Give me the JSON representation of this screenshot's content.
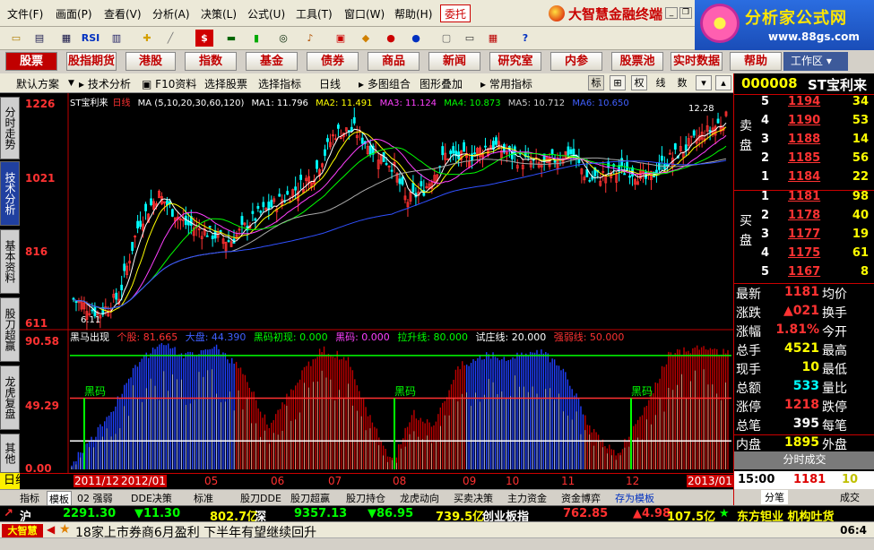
{
  "menu": {
    "items": [
      "文件(F)",
      "画面(P)",
      "查看(V)",
      "分析(A)",
      "决策(L)",
      "公式(U)",
      "工具(T)",
      "窗口(W)",
      "帮助(H)"
    ],
    "active": "委托",
    "brand": "大智慧金融终端"
  },
  "ad": {
    "title": "分析家公式网",
    "url": "www.88gs.com"
  },
  "toolbar": {
    "rsi_label": "RSI"
  },
  "funcbar": {
    "items": [
      "股票",
      "股指期货",
      "港股",
      "指数",
      "基金",
      "债券",
      "商品",
      "新闻",
      "研究室",
      "内参",
      "股票池",
      "实时数据",
      "帮助"
    ],
    "workarea": "工作区"
  },
  "subbar": {
    "default_scheme": "默认方案",
    "tech_analysis": "技术分析",
    "f10": "F10资料",
    "pick_stock": "选择股票",
    "pick_indicator": "选择指标",
    "period": "日线",
    "multi_chart": "多图组合",
    "overlay": "图形叠加",
    "common_ind": "常用指标",
    "btn_biao": "标",
    "btn_quan": "权",
    "btn_xian": "线",
    "btn_shu": "数"
  },
  "lefttabs": [
    "分时走势",
    "技术分析",
    "基本资料",
    "股刀超赢",
    "龙虎复盘",
    "其他"
  ],
  "main_chart": {
    "title": "ST宝利来",
    "period": "日线",
    "ma_params": "MA (5,10,20,30,60,120)",
    "ma1": "MA1: 11.796",
    "ma2": "MA2: 11.491",
    "ma3": "MA3: 11.124",
    "ma4": "MA4: 10.873",
    "ma5": "MA5: 10.712",
    "ma6": "MA6: 10.650",
    "yticks": [
      "1226",
      "1021",
      "816",
      "611"
    ],
    "max_label": "12.28",
    "min_label": "6.11"
  },
  "indicator": {
    "name": "黑马出现",
    "geti": "个股: 81.665",
    "dapan": "大盘: 44.390",
    "chuxian": "黑码初现: 0.000",
    "heima": "黑码: 0.000",
    "lashengxian": "拉升线: 80.000",
    "shizhuangxian": "试庄线: 20.000",
    "qiangruoxian": "强弱线: 50.000",
    "yticks": [
      "90.58",
      "49.29",
      "0.00"
    ],
    "signal_label": "黑码"
  },
  "chart_data": {
    "type": "candlestick",
    "title": "ST宝利来",
    "ylim": [
      611,
      1226
    ],
    "x_labels": [
      "2011/12",
      "2012/01",
      "05",
      "06",
      "07",
      "08",
      "09",
      "10",
      "11",
      "12",
      "2013/01"
    ],
    "indicator_ylim": [
      0,
      90.58
    ],
    "levels": {
      "lashengxian": 80,
      "qiangruoxian": 50,
      "shizhuangxian": 20
    }
  },
  "xaxis": {
    "period_label": "日线",
    "labels": [
      "2011/12",
      "2012/01",
      "05",
      "06",
      "07",
      "08",
      "09",
      "10",
      "11",
      "12",
      "2013/01"
    ]
  },
  "bottom_tabs": [
    "指标",
    "模板",
    "02 强弱",
    "DDE决策",
    "标准",
    "股刀DDE",
    "股刀超赢",
    "股刀持仓",
    "龙虎动向",
    "买卖决策",
    "主力资金",
    "资金博弈",
    "存为模板"
  ],
  "stock": {
    "code": "000008",
    "name": "ST宝利来"
  },
  "orderbook": {
    "sell_label": "卖盘",
    "buy_label": "买盘",
    "sell": [
      {
        "level": "5",
        "price": "1194",
        "qty": "34"
      },
      {
        "level": "4",
        "price": "1190",
        "qty": "53"
      },
      {
        "level": "3",
        "price": "1188",
        "qty": "14"
      },
      {
        "level": "2",
        "price": "1185",
        "qty": "56"
      },
      {
        "level": "1",
        "price": "1184",
        "qty": "22"
      }
    ],
    "buy": [
      {
        "level": "1",
        "price": "1181",
        "qty": "98"
      },
      {
        "level": "2",
        "price": "1178",
        "qty": "40"
      },
      {
        "level": "3",
        "price": "1177",
        "qty": "19"
      },
      {
        "level": "4",
        "price": "1175",
        "qty": "61"
      },
      {
        "level": "5",
        "price": "1167",
        "qty": "8"
      }
    ]
  },
  "quote": [
    {
      "l1": "最新",
      "v": "1181",
      "l2": "均价",
      "color": "#ff3232"
    },
    {
      "l1": "涨跌",
      "v": "▲021",
      "l2": "换手",
      "color": "#ff3232"
    },
    {
      "l1": "涨幅",
      "v": "1.81%",
      "l2": "今开",
      "color": "#ff3232"
    },
    {
      "l1": "总手",
      "v": "4521",
      "l2": "最高",
      "color": "#ffff00"
    },
    {
      "l1": "现手",
      "v": "10",
      "l2": "最低",
      "color": "#ffff00"
    },
    {
      "l1": "总额",
      "v": "533",
      "l2": "量比",
      "color": "#00ffff"
    },
    {
      "l1": "涨停",
      "v": "1218",
      "l2": "跌停",
      "color": "#ff3232"
    },
    {
      "l1": "总笔",
      "v": "395",
      "l2": "每笔",
      "color": "#ffffff"
    },
    {
      "l1": "内盘",
      "v": "1895",
      "l2": "外盘",
      "color": "#ffff00"
    }
  ],
  "timeshare": {
    "title": "分时成交",
    "time": "15:00",
    "price": "1181",
    "qty": "10"
  },
  "rtabs": {
    "tab1": "分笔",
    "tab2": "成交"
  },
  "status": {
    "sh_label": "沪",
    "sh_index": "2291.30",
    "sh_change": "▼11.30",
    "sh_amount": "802.7亿",
    "sz_label": "深",
    "sz_index": "9357.13",
    "sz_change": "▼86.95",
    "sz_amount": "739.5亿",
    "cy_label": "创业板指",
    "cy_index": "762.85",
    "cy_change": "▲4.98",
    "cy_amount": "107.5亿",
    "ticker": "东方钽业 机构吐货"
  },
  "news": {
    "logo": "大智慧",
    "text": "18家上市券商6月盈利  下半年有望继续回升",
    "time": "06:4"
  }
}
